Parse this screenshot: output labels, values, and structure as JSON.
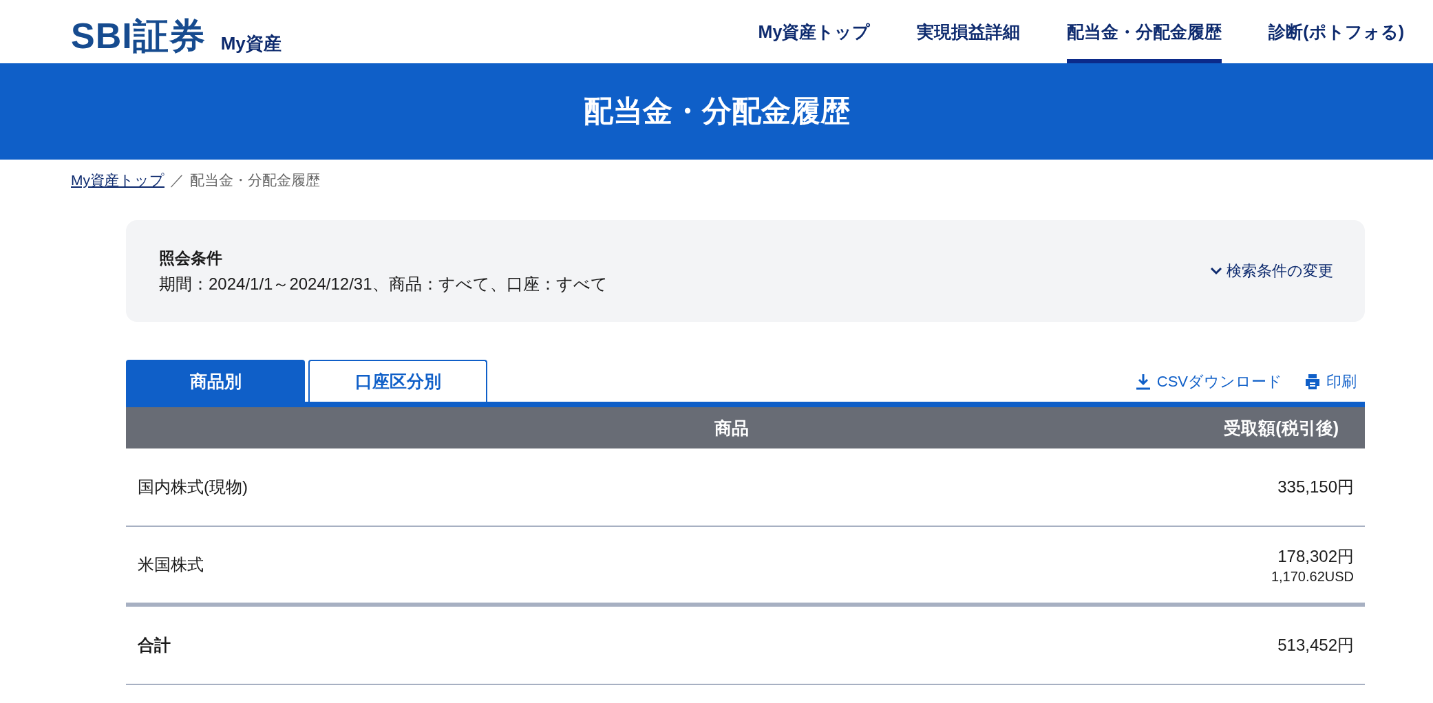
{
  "header": {
    "logo": "SBI証券",
    "logo_sub": "My資産",
    "nav": [
      {
        "label": "My資産トップ",
        "selected": false
      },
      {
        "label": "実現損益詳細",
        "selected": false
      },
      {
        "label": "配当金・分配金履歴",
        "selected": true
      },
      {
        "label": "診断(ポトフォる)",
        "selected": false
      }
    ]
  },
  "page_title": "配当金・分配金履歴",
  "breadcrumb": {
    "separator": "／",
    "items": [
      {
        "label": "My資産トップ",
        "kind": "link"
      },
      {
        "label": "配当金・分配金履歴",
        "kind": "current"
      }
    ]
  },
  "conditions": {
    "heading": "照会条件",
    "summary": "期間：2024/1/1～2024/12/31、商品：すべて、口座：すべて",
    "toggle": "検索条件の変更"
  },
  "tabs": [
    {
      "label": "商品別",
      "selected": true
    },
    {
      "label": "口座区分別",
      "selected": false
    }
  ],
  "actions": [
    {
      "label": "CSVダウンロード",
      "kind": "download"
    },
    {
      "label": "印刷",
      "kind": "print"
    }
  ],
  "table": {
    "columns": [
      "商品",
      "受取額(税引後)"
    ],
    "rows": [
      {
        "product": "国内株式(現物)",
        "amount": "335,150円"
      },
      {
        "product": "米国株式",
        "amount": "178,302円",
        "amount_sub": "1,170.62USD"
      }
    ],
    "total": {
      "label": "合計",
      "amount": "513,452円"
    }
  }
}
